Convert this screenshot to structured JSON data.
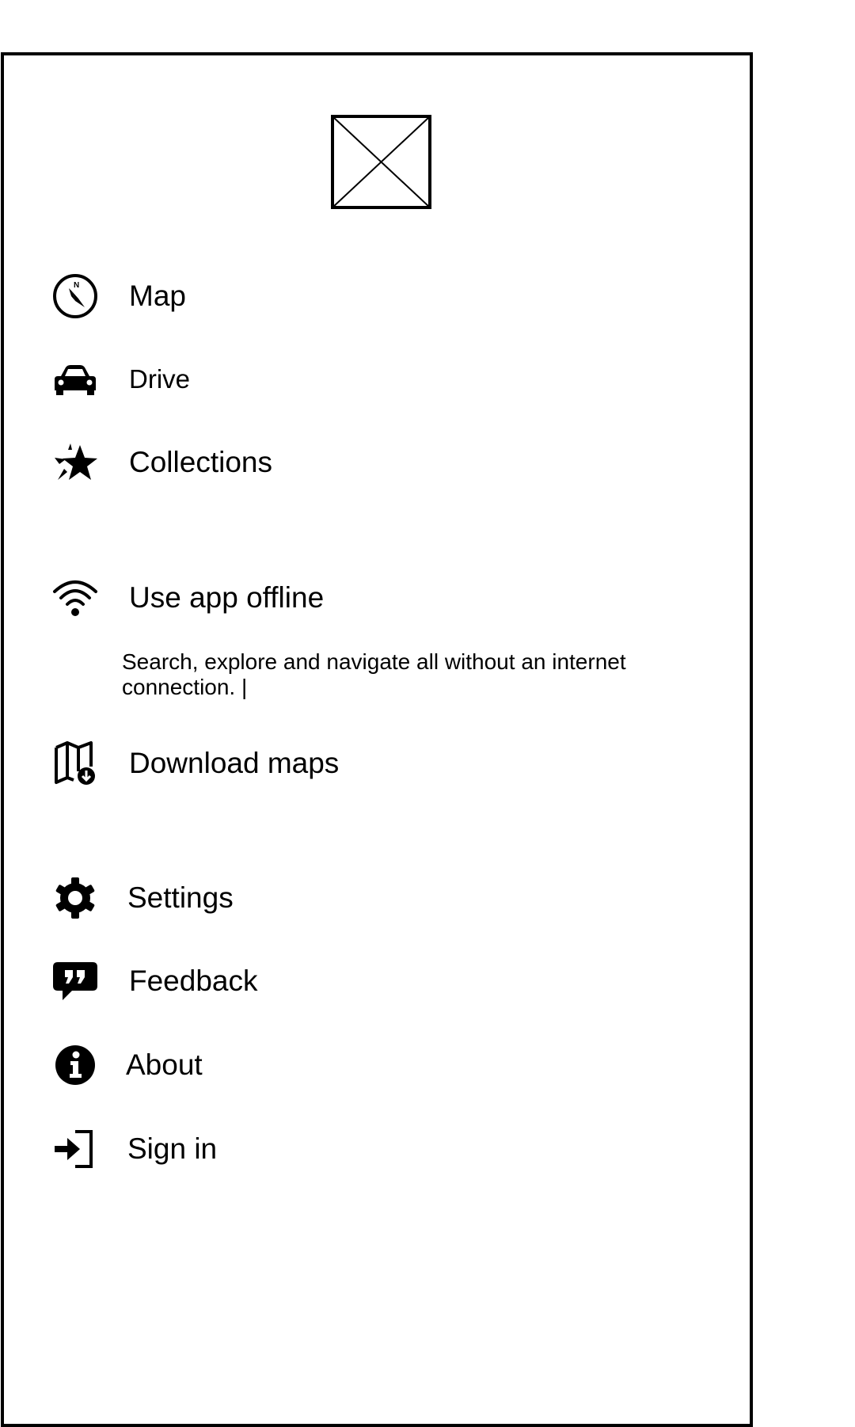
{
  "menu": {
    "items": [
      {
        "label": "Map",
        "icon": "compass-icon"
      },
      {
        "label": "Drive",
        "icon": "car-icon"
      },
      {
        "label": "Collections",
        "icon": "star-icon"
      },
      {
        "label": "Use app offline",
        "icon": "wifi-icon"
      },
      {
        "label": "Download maps",
        "icon": "map-download-icon"
      },
      {
        "label": "Settings",
        "icon": "gear-icon"
      },
      {
        "label": "Feedback",
        "icon": "feedback-icon"
      },
      {
        "label": "About",
        "icon": "info-icon"
      },
      {
        "label": "Sign in",
        "icon": "sign-in-icon"
      }
    ]
  },
  "offline": {
    "description": "Search, explore and navigate all without an internet connection. |"
  }
}
